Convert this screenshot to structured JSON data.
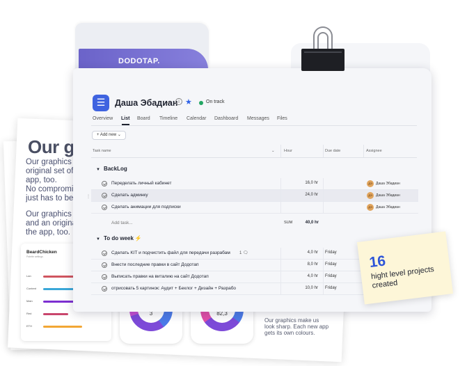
{
  "background": {
    "heading": "Our graphics",
    "paragraph1": [
      "Our graphics make us",
      "original set of",
      "app, too.",
      "No compromise",
      "just has to be p"
    ],
    "paragraph2": [
      "Our graphics m",
      "and an origina",
      "the app, too."
    ],
    "card": {
      "title": "BeardChicken",
      "subtitle": "Palette settings",
      "rows": [
        {
          "label": "Lan",
          "color": "#d0555f",
          "width": 0.55
        },
        {
          "label": "Content",
          "color": "#3aa7d8",
          "width": 0.75
        },
        {
          "label": "Main",
          "color": "#7d2fd1",
          "width": 0.82
        },
        {
          "label": "Red",
          "color": "#c9466d",
          "width": 0.4
        },
        {
          "label": "ETH",
          "color": "#f2a634",
          "width": 0.62
        }
      ]
    },
    "donuts": [
      {
        "value": "3"
      },
      {
        "value": "82,3"
      }
    ],
    "caption": "Our graphics make us look sharp. Each new app gets its own colours."
  },
  "folder": {
    "label": "DODOTAP."
  },
  "project": {
    "icon": "list-icon",
    "title": "Даша Эбадиан",
    "status": "On track",
    "status_color": "#22a663",
    "accent": "#3f63e0"
  },
  "tabs": [
    "Overview",
    "List",
    "Board",
    "Timeline",
    "Calendar",
    "Dashboard",
    "Messages",
    "Files"
  ],
  "toolbar": {
    "add_new": "+ Add new ⌄"
  },
  "columns": {
    "task_name": "Task name",
    "hour": "Hour",
    "due_date": "Due date",
    "assignee": "Assignee"
  },
  "sections": [
    {
      "name": "BackLog",
      "tasks": [
        {
          "name": "Переделать личный кабинет",
          "hours": "16,0 hr",
          "due": "",
          "assignee": "Даша Эбадиан"
        },
        {
          "name": "Сделать админку",
          "hours": "24,0 hr",
          "due": "",
          "assignee": "Даша Эбадиан"
        },
        {
          "name": "Сделать анимации для подписки",
          "hours": "",
          "due": "",
          "assignee": "Даша Эбадиан"
        }
      ],
      "add_task": "Add task...",
      "sum_label": "SUM",
      "sum_value": "40,0 hr"
    },
    {
      "name": "To do week",
      "tasks": [
        {
          "name": "Сделать KIT и подчистить файл для передачи разрабам",
          "comments": "1",
          "hours": "4,0 hr",
          "due": "Friday"
        },
        {
          "name": "Внести последние правки в сайт Додотап",
          "hours": "8,0 hr",
          "due": "Friday"
        },
        {
          "name": "Выписать правки на виталию на сайт Додотап",
          "hours": "4,0 hr",
          "due": "Friday"
        },
        {
          "name": "отрисовать 5 картинок: Аудит + Беклог + Дизайн + Разрабо",
          "hours": "10,0 hr",
          "due": "Friday"
        }
      ]
    }
  ],
  "avatar_initials": "ДЭ",
  "sticky": {
    "number": "16",
    "text": "hight level projects created"
  }
}
